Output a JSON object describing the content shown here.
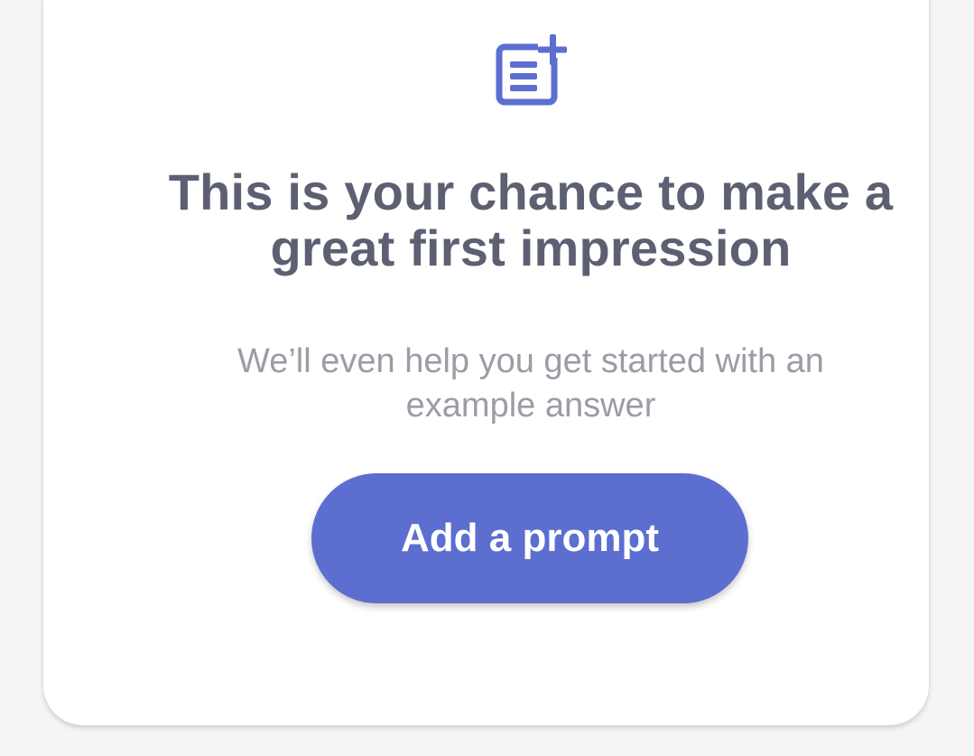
{
  "empty_state": {
    "icon": "note-add-icon",
    "title": "This is your chance to make a great first impression",
    "subtitle": "We’ll even help you get started with an example answer",
    "button_label": "Add a prompt"
  },
  "colors": {
    "accent": "#5c6ed0",
    "title": "#5d6072",
    "subtitle": "#9b9ca6",
    "background": "#f5f5f7",
    "card": "#ffffff"
  }
}
